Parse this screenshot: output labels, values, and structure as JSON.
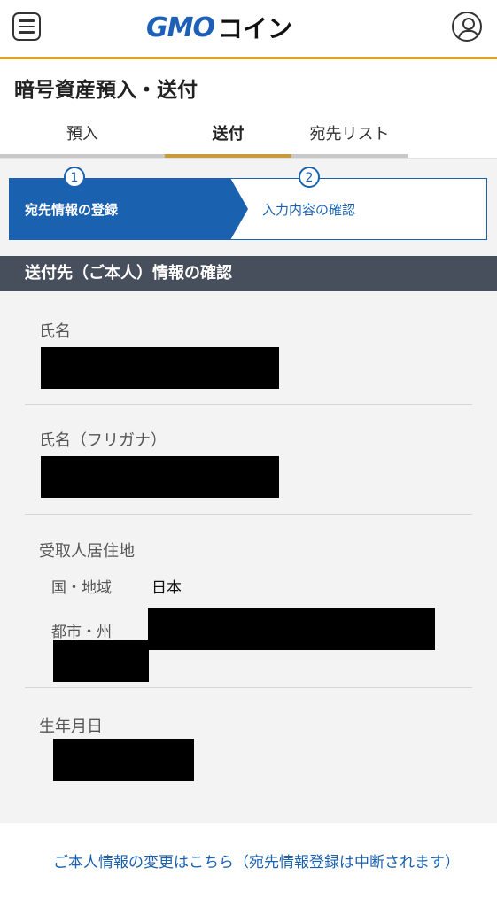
{
  "header": {
    "logo_gmo": "GMO",
    "logo_coin": "コイン",
    "brand_color": "#1e5fb8",
    "accent_color": "#e6a21c"
  },
  "page": {
    "title": "暗号資産預入・送付"
  },
  "tabs": [
    {
      "label": "預入",
      "active": false
    },
    {
      "label": "送付",
      "active": true
    },
    {
      "label": "宛先リスト",
      "active": false
    }
  ],
  "steps": [
    {
      "number": "1",
      "label": "宛先情報の登録",
      "active": true
    },
    {
      "number": "2",
      "label": "入力内容の確認",
      "active": false
    }
  ],
  "section": {
    "title": "送付先（ご本人）情報の確認"
  },
  "fields": {
    "name_label": "氏名",
    "kana_label": "氏名（フリガナ）",
    "residence_label": "受取人居住地",
    "country_label": "国・地域",
    "country_value": "日本",
    "city_label": "都市・州",
    "birthdate_label": "生年月日"
  },
  "link": {
    "change_info": "ご本人情報の変更はこちら（宛先情報登録は中断されます）"
  }
}
